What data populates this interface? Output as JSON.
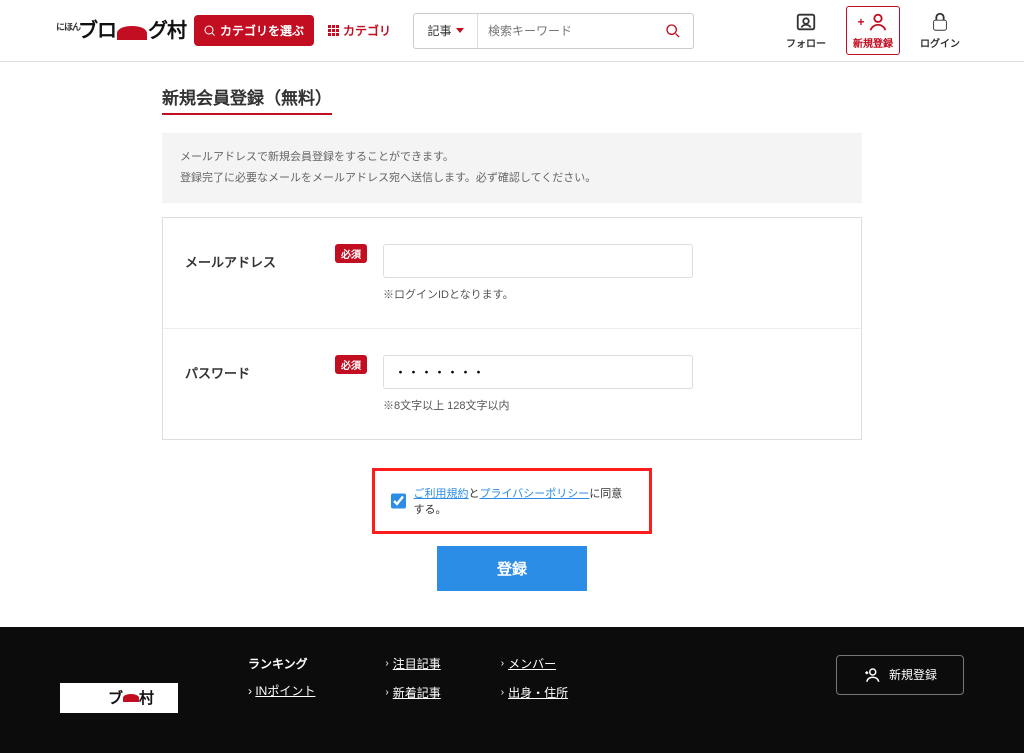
{
  "header": {
    "logo_sub": "にほん",
    "logo_main_left": "ブロ",
    "logo_main_right": "グ村",
    "select_category_btn": "カテゴリを選ぶ",
    "category_link": "カテゴリ",
    "search_select": "記事",
    "search_placeholder": "検索キーワード",
    "follow": "フォロー",
    "signup": "新規登録",
    "login": "ログイン"
  },
  "page": {
    "title": "新規会員登録（無料）",
    "notice_line1": "メールアドレスで新規会員登録をすることができます。",
    "notice_line2": "登録完了に必要なメールをメールアドレス宛へ送信します。必ず確認してください。",
    "email_label": "メールアドレス",
    "required_badge": "必須",
    "email_hint": "※ログインIDとなります。",
    "password_label": "パスワード",
    "password_value": "・・・・・・・",
    "password_hint": "※8文字以上 128文字以内",
    "agree_pre": "ご利用規約",
    "agree_mid": "と",
    "agree_link": "プライバシーポリシー",
    "agree_post": "に同意する。",
    "submit": "登録"
  },
  "footer": {
    "ranking_heading": "ランキング",
    "in_point": "INポイント",
    "links_col1_1": "注目記事",
    "links_col1_2": "新着記事",
    "links_col2_1": "メンバー",
    "links_col2_2": "出身・住所",
    "signup": "新規登録"
  }
}
